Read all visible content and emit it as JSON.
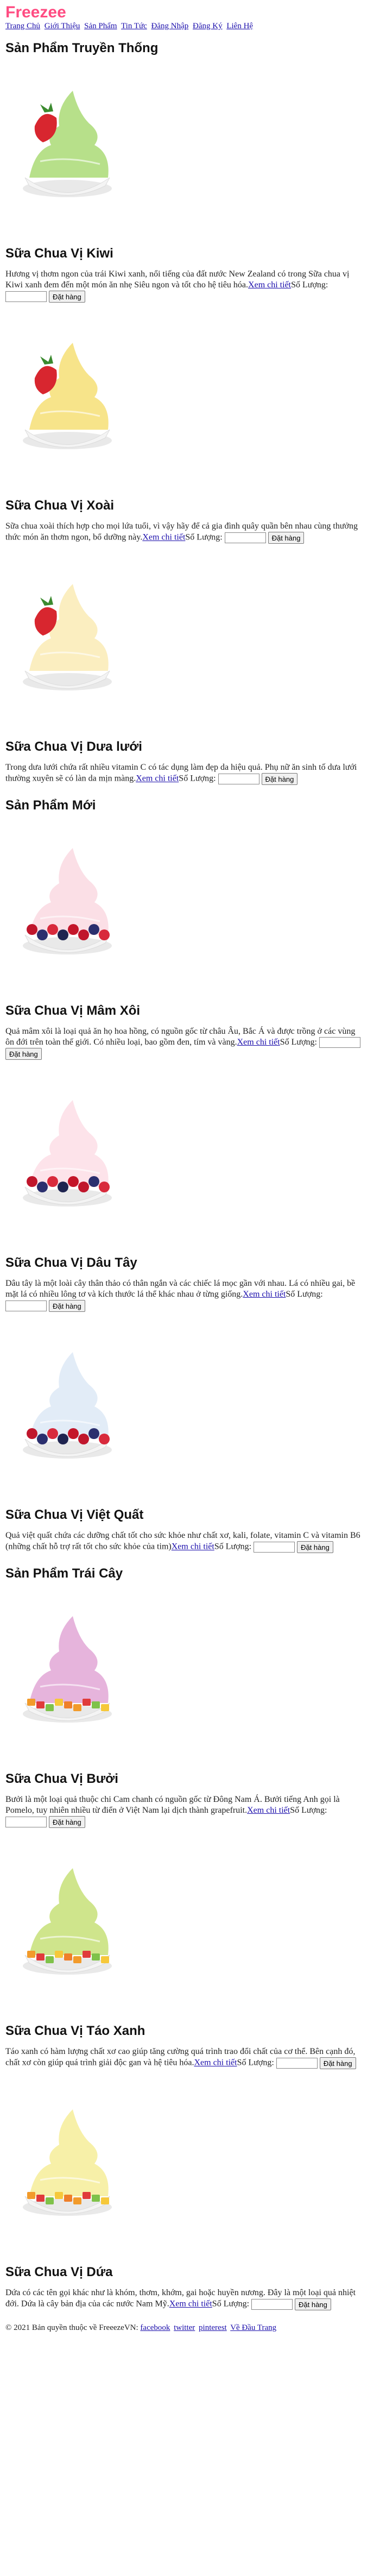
{
  "brand": {
    "name": "Freeze",
    "suffix": "e"
  },
  "nav": [
    "Trang Chủ",
    "Giới Thiệu",
    "Sản Phẩm",
    "Tin Tức",
    "Đăng Nhập",
    "Đăng Ký",
    "Liên Hệ"
  ],
  "sections": [
    {
      "title": "Sản Phẩm Truyền Thống",
      "products": [
        {
          "name": "Sữa Chua Vị Kiwi",
          "desc": "Hương vị thơm ngon của trái Kiwi xanh, nổi tiếng của đất nước New Zealand có trong Sữa chua vị Kiwi xanh đem đến một món ăn nhẹ Siêu ngon và tốt cho hệ tiêu hóa.",
          "link": "Xem chi tiết",
          "qty_label": "Số Lượng:",
          "button": "Đặt hàng",
          "icon": "strawberry-frozen-yogurt-kiwi",
          "color": "#b7e08a"
        },
        {
          "name": "Sữa Chua Vị Xoài",
          "desc": "Sữa chua xoài thích hợp cho mọi lứa tuổi, vì vậy hãy để cả gia đình quây quần bên nhau cùng thưởng thức món ăn thơm ngon, bổ dưỡng này.",
          "link": "Xem chi tiết",
          "qty_label": "Số Lượng:",
          "button": "Đặt hàng",
          "icon": "strawberry-frozen-yogurt-mango",
          "color": "#f7e48a"
        },
        {
          "name": "Sữa Chua Vị Dưa lưới",
          "desc": "Trong dưa lưới chứa rất nhiều vitamin C có tác dụng làm đẹp da hiệu quả. Phụ nữ ăn sinh tố dưa lưới thường xuyên sẽ có làn da mịn màng.",
          "link": "Xem chi tiết",
          "qty_label": "Số Lượng:",
          "button": "Đặt hàng",
          "icon": "strawberry-frozen-yogurt-melon",
          "color": "#fbeec0"
        }
      ]
    },
    {
      "title": "Sản Phẩm Mới",
      "products": [
        {
          "name": "Sữa Chua Vị Mâm Xôi",
          "desc": "Quả mâm xôi là loại quả ăn họ hoa hồng, có nguồn gốc từ châu Âu, Bắc Á và được trồng ở các vùng ôn đới trên toàn thế giới. Có nhiều loại, bao gồm đen, tím và vàng.",
          "link": "Xem chi tiết",
          "qty_label": "Số Lượng:",
          "button": "Đặt hàng",
          "icon": "berry-frozen-yogurt-raspberry",
          "color": "#fbdfe6"
        },
        {
          "name": "Sữa Chua Vị Dâu Tây",
          "desc": "Dâu tây là một loài cây thân thảo có thân ngắn và các chiếc lá mọc gần với nhau. Lá có nhiều gai, bề mặt lá có nhiều lông tơ và kích thước lá thể khác nhau ở từng giống.",
          "link": "Xem chi tiết",
          "qty_label": "Số Lượng:",
          "button": "Đặt hàng",
          "icon": "berry-frozen-yogurt-strawberry",
          "color": "#fde3ea"
        },
        {
          "name": "Sữa Chua Vị Việt Quất",
          "desc": "Quả việt quất chứa các dưỡng chất tốt cho sức khỏe như chất xơ, kali, folate, vitamin C và vitamin B6 (những chất hỗ trợ rất tốt cho sức khỏe của tim)",
          "link": "Xem chi tiết",
          "qty_label": "Số Lượng:",
          "button": "Đặt hàng",
          "icon": "berry-frozen-yogurt-blueberry",
          "color": "#e2ecf7"
        }
      ]
    },
    {
      "title": "Sản Phẩm Trái Cây",
      "products": [
        {
          "name": "Sữa Chua Vị Bưởi",
          "desc": "Bưởi là một loại quả thuộc chi Cam chanh có nguồn gốc từ Đông Nam Á. Bưởi tiếng Anh gọi là Pomelo, tuy nhiên nhiều từ điển ở Việt Nam lại dịch thành grapefruit.",
          "link": "Xem chi tiết",
          "qty_label": "Số Lượng:",
          "button": "Đặt hàng",
          "icon": "fruit-frozen-yogurt-pomelo",
          "color": "#e6b4dc"
        },
        {
          "name": "Sữa Chua Vị Táo Xanh",
          "desc": "Táo xanh có hàm lượng chất xơ cao giúp tăng cường quá trình trao đổi chất của cơ thể. Bên cạnh đó, chất xơ còn giúp quá trình giải độc gan và hệ tiêu hóa.",
          "link": "Xem chi tiết",
          "qty_label": "Số Lượng:",
          "button": "Đặt hàng",
          "icon": "fruit-frozen-yogurt-green-apple",
          "color": "#cfe58c"
        },
        {
          "name": "Sữa Chua Vị Dứa",
          "desc": "Dứa có các tên gọi khác như là khóm, thơm, khớm, gai hoặc huyền nương. Đây là một loại quả nhiệt đới. Dứa là cây bản địa của các nước Nam Mỹ.",
          "link": "Xem chi tiết",
          "qty_label": "Số Lượng:",
          "button": "Đặt hàng",
          "icon": "fruit-frozen-yogurt-pineapple",
          "color": "#f7f0a8"
        }
      ]
    }
  ],
  "footer": {
    "copyright": "© 2021 Bản quyền thuộc về FreeezeVN:",
    "links": [
      "facebook",
      "twitter",
      "pinterest",
      "Về Đầu Trang"
    ]
  }
}
